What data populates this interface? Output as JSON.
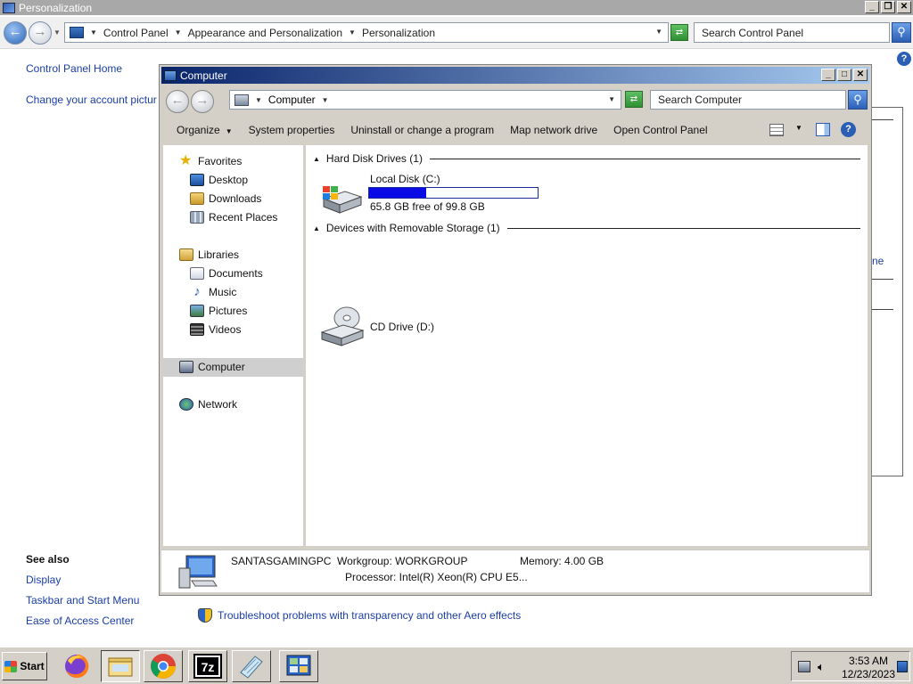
{
  "background_window": {
    "title": "Personalization",
    "breadcrumb": [
      "Control Panel",
      "Appearance and Personalization",
      "Personalization"
    ],
    "search_placeholder": "Search Control Panel",
    "sidebar": {
      "home": "Control Panel Home",
      "account": "Change your account pictur",
      "see_also": "See also",
      "links": [
        "Display",
        "Taskbar and Start Menu",
        "Ease of Access Center"
      ]
    },
    "troubleshoot": "Troubleshoot problems with transparency and other Aero effects",
    "partial_link": "ne"
  },
  "explorer": {
    "title": "Computer",
    "address": "Computer",
    "search_placeholder": "Search Computer",
    "toolbar": [
      "Organize",
      "System properties",
      "Uninstall or change a program",
      "Map network drive",
      "Open Control Panel"
    ],
    "nav": {
      "favorites": "Favorites",
      "favorites_items": [
        "Desktop",
        "Downloads",
        "Recent Places"
      ],
      "libraries": "Libraries",
      "libraries_items": [
        "Documents",
        "Music",
        "Pictures",
        "Videos"
      ],
      "computer": "Computer",
      "network": "Network"
    },
    "groups": {
      "hard_disks": "Hard Disk Drives (1)",
      "removable": "Devices with Removable Storage (1)"
    },
    "drives": {
      "local_name": "Local Disk (C:)",
      "local_free": "65.8 GB free of 99.8 GB",
      "local_used_fraction": 0.34,
      "cd_name": "CD Drive (D:)"
    },
    "details": {
      "computer_name": "SANTASGAMINGPC",
      "workgroup": "Workgroup:  WORKGROUP",
      "memory": "Memory:  4.00 GB",
      "processor": "Processor:  Intel(R) Xeon(R) CPU E5..."
    }
  },
  "taskbar": {
    "start": "Start",
    "time": "3:53 AM",
    "date": "12/23/2023"
  },
  "colors": {
    "title_active": "#0a246a",
    "link": "#1a3ea5",
    "disk_fill": "#0a0ae6"
  }
}
